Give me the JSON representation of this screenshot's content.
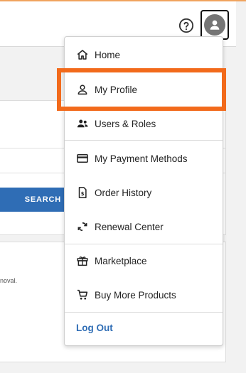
{
  "header": {
    "help_icon": "help-circle-icon",
    "avatar_icon": "user-avatar-icon"
  },
  "background": {
    "search_label": "SEARCH",
    "partial_text": "noval."
  },
  "menu": {
    "items": [
      {
        "label": "Home",
        "icon": "home-icon"
      },
      {
        "label": "My Profile",
        "icon": "person-icon"
      },
      {
        "label": "Users & Roles",
        "icon": "users-icon"
      },
      {
        "label": "My Payment Methods",
        "icon": "credit-card-icon"
      },
      {
        "label": "Order History",
        "icon": "invoice-icon"
      },
      {
        "label": "Renewal Center",
        "icon": "renew-icon"
      },
      {
        "label": "Marketplace",
        "icon": "gift-icon"
      },
      {
        "label": "Buy More Products",
        "icon": "cart-icon"
      }
    ],
    "logout_label": "Log Out"
  },
  "colors": {
    "highlight": "#f26a1b",
    "link": "#2f6db5",
    "search_button": "#2f6db5",
    "top_accent": "#f0a35e"
  }
}
